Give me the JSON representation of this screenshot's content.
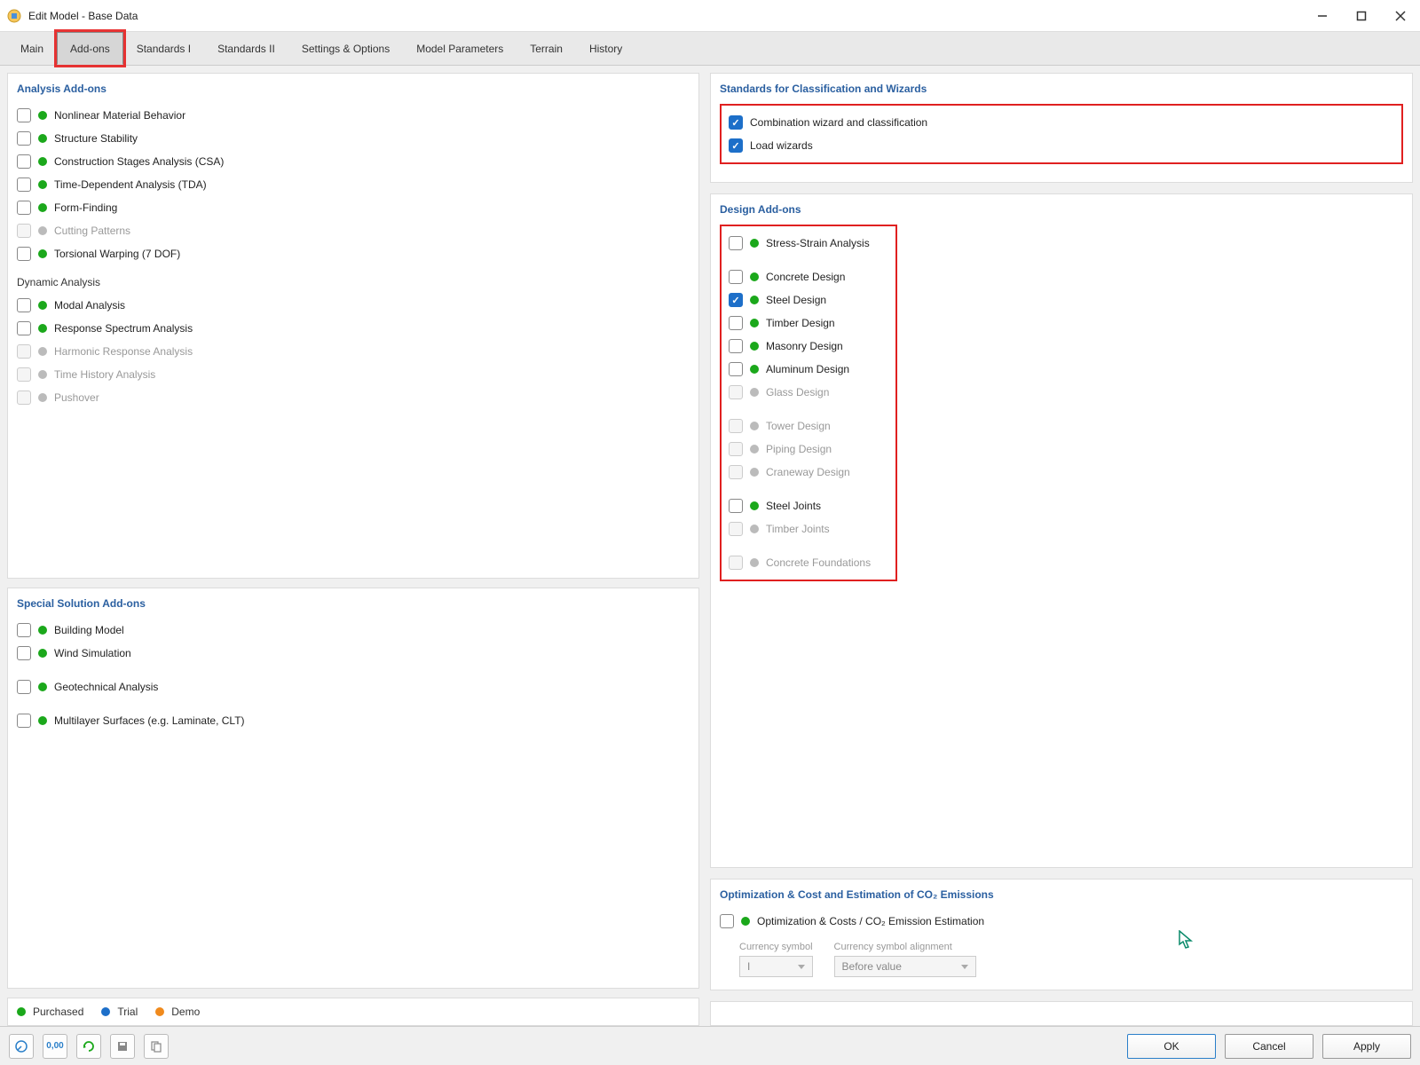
{
  "window": {
    "title": "Edit Model - Base Data"
  },
  "tabs": [
    "Main",
    "Add-ons",
    "Standards I",
    "Standards II",
    "Settings & Options",
    "Model Parameters",
    "Terrain",
    "History"
  ],
  "left": {
    "analysis": {
      "title": "Analysis Add-ons",
      "items": [
        {
          "label": "Nonlinear Material Behavior",
          "checked": false,
          "status": "green",
          "disabled": false
        },
        {
          "label": "Structure Stability",
          "checked": false,
          "status": "green",
          "disabled": false
        },
        {
          "label": "Construction Stages Analysis (CSA)",
          "checked": false,
          "status": "green",
          "disabled": false
        },
        {
          "label": "Time-Dependent Analysis (TDA)",
          "checked": false,
          "status": "green",
          "disabled": false
        },
        {
          "label": "Form-Finding",
          "checked": false,
          "status": "green",
          "disabled": false
        },
        {
          "label": "Cutting Patterns",
          "checked": false,
          "status": "gray",
          "disabled": true
        },
        {
          "label": "Torsional Warping (7 DOF)",
          "checked": false,
          "status": "green",
          "disabled": false
        }
      ],
      "dynamic_title": "Dynamic Analysis",
      "dynamic_items": [
        {
          "label": "Modal Analysis",
          "checked": false,
          "status": "green",
          "disabled": false
        },
        {
          "label": "Response Spectrum Analysis",
          "checked": false,
          "status": "green",
          "disabled": false
        },
        {
          "label": "Harmonic Response Analysis",
          "checked": false,
          "status": "gray",
          "disabled": true
        },
        {
          "label": "Time History Analysis",
          "checked": false,
          "status": "gray",
          "disabled": true
        },
        {
          "label": "Pushover",
          "checked": false,
          "status": "gray",
          "disabled": true
        }
      ]
    },
    "special": {
      "title": "Special Solution Add-ons",
      "items": [
        {
          "label": "Building Model",
          "checked": false,
          "status": "green",
          "disabled": false
        },
        {
          "label": "Wind Simulation",
          "checked": false,
          "status": "green",
          "disabled": false
        },
        {
          "label": "Geotechnical Analysis",
          "checked": false,
          "status": "green",
          "disabled": false,
          "sep": true
        },
        {
          "label": "Multilayer Surfaces (e.g. Laminate, CLT)",
          "checked": false,
          "status": "green",
          "disabled": false,
          "sep": true
        }
      ]
    }
  },
  "right": {
    "standards": {
      "title": "Standards for Classification and Wizards",
      "items": [
        {
          "label": "Combination wizard and classification",
          "checked": true
        },
        {
          "label": "Load wizards",
          "checked": true
        }
      ]
    },
    "design": {
      "title": "Design Add-ons",
      "groups": [
        [
          {
            "label": "Stress-Strain Analysis",
            "checked": false,
            "status": "green",
            "disabled": false
          }
        ],
        [
          {
            "label": "Concrete Design",
            "checked": false,
            "status": "green",
            "disabled": false
          },
          {
            "label": "Steel Design",
            "checked": true,
            "status": "green",
            "disabled": false
          },
          {
            "label": "Timber Design",
            "checked": false,
            "status": "green",
            "disabled": false
          },
          {
            "label": "Masonry Design",
            "checked": false,
            "status": "green",
            "disabled": false
          },
          {
            "label": "Aluminum Design",
            "checked": false,
            "status": "green",
            "disabled": false
          },
          {
            "label": "Glass Design",
            "checked": false,
            "status": "gray",
            "disabled": true
          }
        ],
        [
          {
            "label": "Tower Design",
            "checked": false,
            "status": "gray",
            "disabled": true
          },
          {
            "label": "Piping Design",
            "checked": false,
            "status": "gray",
            "disabled": true
          },
          {
            "label": "Craneway Design",
            "checked": false,
            "status": "gray",
            "disabled": true
          }
        ],
        [
          {
            "label": "Steel Joints",
            "checked": false,
            "status": "green",
            "disabled": false
          },
          {
            "label": "Timber Joints",
            "checked": false,
            "status": "gray",
            "disabled": true
          }
        ],
        [
          {
            "label": "Concrete Foundations",
            "checked": false,
            "status": "gray",
            "disabled": true
          }
        ]
      ]
    },
    "optimization": {
      "title": "Optimization & Cost and Estimation of CO₂ Emissions",
      "item": {
        "label": "Optimization & Costs / CO₂ Emission Estimation",
        "checked": false,
        "status": "green"
      },
      "currency_label": "Currency symbol",
      "currency_value": "I",
      "alignment_label": "Currency symbol alignment",
      "alignment_value": "Before value"
    }
  },
  "legend": {
    "purchased": "Purchased",
    "trial": "Trial",
    "demo": "Demo"
  },
  "buttons": {
    "ok": "OK",
    "cancel": "Cancel",
    "apply": "Apply"
  }
}
